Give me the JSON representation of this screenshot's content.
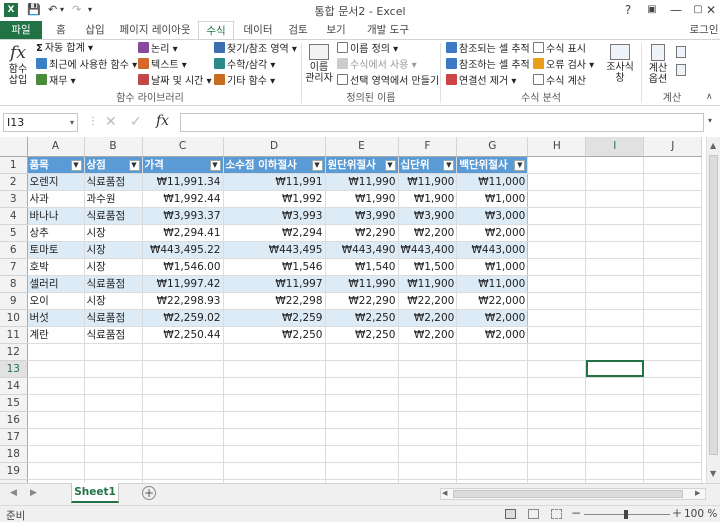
{
  "window": {
    "title": "통합 문서2 - Excel",
    "login": "로그인"
  },
  "tabs": [
    "파일",
    "홈",
    "삽입",
    "페이지 레이아웃",
    "수식",
    "데이터",
    "검토",
    "보기",
    "개발 도구"
  ],
  "ribbon": {
    "insert_function": "함수\n삽입",
    "autosum": "자동 합계",
    "recent": "최근에 사용한 함수",
    "financial": "재무",
    "logical": "논리",
    "text": "텍스트",
    "datetime": "날짜 및 시간",
    "lookup": "찾기/참조 영역",
    "math": "수학/삼각",
    "more": "기타 함수",
    "group_library": "함수 라이브러리",
    "name_manager": "이름\n관리자",
    "define_name": "이름 정의",
    "use_in_formula": "수식에서 사용",
    "create_from_sel": "선택 영역에서 만들기",
    "group_names": "정의된 이름",
    "trace_precedents": "참조되는 셀 추적",
    "trace_dependents": "참조하는 셀 추적",
    "remove_arrows": "연결선 제거",
    "show_formulas": "수식 표시",
    "error_check": "오류 검사",
    "evaluate": "수식 계산",
    "watch_window": "조사식\n창",
    "group_audit": "수식 분석",
    "calc_options": "계산\n옵션",
    "group_calc": "계산"
  },
  "formula_bar": {
    "name_box": "I13",
    "formula": ""
  },
  "columns": [
    "A",
    "B",
    "C",
    "D",
    "E",
    "F",
    "G",
    "H",
    "I",
    "J"
  ],
  "headers": [
    "품목",
    "상점",
    "가격",
    "소수점 이하절사",
    "원단위절사",
    "십단위",
    "백단위절사"
  ],
  "rows": [
    [
      "오렌지",
      "식료품점",
      "₩11,991.34",
      "₩11,991",
      "₩11,990",
      "₩11,900",
      "₩11,000"
    ],
    [
      "사과",
      "과수원",
      "₩1,992.44",
      "₩1,992",
      "₩1,990",
      "₩1,900",
      "₩1,000"
    ],
    [
      "바나나",
      "식료품점",
      "₩3,993.37",
      "₩3,993",
      "₩3,990",
      "₩3,900",
      "₩3,000"
    ],
    [
      "상추",
      "시장",
      "₩2,294.41",
      "₩2,294",
      "₩2,290",
      "₩2,200",
      "₩2,000"
    ],
    [
      "토마토",
      "시장",
      "₩443,495.22",
      "₩443,495",
      "₩443,490",
      "₩443,400",
      "₩443,000"
    ],
    [
      "호박",
      "시장",
      "₩1,546.00",
      "₩1,546",
      "₩1,540",
      "₩1,500",
      "₩1,000"
    ],
    [
      "셀러리",
      "식료품점",
      "₩11,997.42",
      "₩11,997",
      "₩11,990",
      "₩11,900",
      "₩11,000"
    ],
    [
      "오이",
      "시장",
      "₩22,298.93",
      "₩22,298",
      "₩22,290",
      "₩22,200",
      "₩22,000"
    ],
    [
      "버섯",
      "식료품점",
      "₩2,259.02",
      "₩2,259",
      "₩2,250",
      "₩2,200",
      "₩2,000"
    ],
    [
      "계란",
      "식료품점",
      "₩2,250.44",
      "₩2,250",
      "₩2,250",
      "₩2,200",
      "₩2,000"
    ]
  ],
  "row_numbers": [
    "1",
    "2",
    "3",
    "4",
    "5",
    "6",
    "7",
    "8",
    "9",
    "10",
    "11",
    "12",
    "13",
    "14",
    "15",
    "16",
    "17",
    "18",
    "19",
    "20"
  ],
  "sheet_tab": "Sheet1",
  "status": {
    "ready": "준비",
    "zoom": "100 %"
  }
}
